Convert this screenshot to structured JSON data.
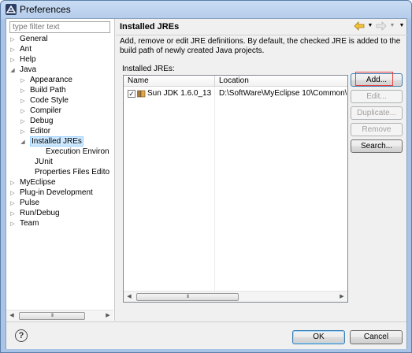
{
  "window": {
    "title": "Preferences",
    "icon": "eclipse-icon"
  },
  "filter": {
    "placeholder": "type filter text"
  },
  "tree": {
    "items": [
      {
        "label": "General",
        "expandable": true,
        "expanded": false
      },
      {
        "label": "Ant",
        "expandable": true,
        "expanded": false
      },
      {
        "label": "Help",
        "expandable": true,
        "expanded": false
      },
      {
        "label": "Java",
        "expandable": true,
        "expanded": true
      },
      {
        "label": "Appearance",
        "expandable": true,
        "expanded": false
      },
      {
        "label": "Build Path",
        "expandable": true,
        "expanded": false
      },
      {
        "label": "Code Style",
        "expandable": true,
        "expanded": false
      },
      {
        "label": "Compiler",
        "expandable": true,
        "expanded": false
      },
      {
        "label": "Debug",
        "expandable": true,
        "expanded": false
      },
      {
        "label": "Editor",
        "expandable": true,
        "expanded": false
      },
      {
        "label": "Installed JREs",
        "expandable": true,
        "expanded": true,
        "selected": true
      },
      {
        "label": "Execution Environ",
        "expandable": false
      },
      {
        "label": "JUnit",
        "expandable": false
      },
      {
        "label": "Properties Files Edito",
        "expandable": false
      },
      {
        "label": "MyEclipse",
        "expandable": true,
        "expanded": false
      },
      {
        "label": "Plug-in Development",
        "expandable": true,
        "expanded": false
      },
      {
        "label": "Pulse",
        "expandable": true,
        "expanded": false
      },
      {
        "label": "Run/Debug",
        "expandable": true,
        "expanded": false
      },
      {
        "label": "Team",
        "expandable": true,
        "expanded": false
      }
    ]
  },
  "page": {
    "title": "Installed JREs",
    "description": "Add, remove or edit JRE definitions. By default, the checked JRE is added to the build path of newly created Java projects.",
    "list_label": "Installed JREs:"
  },
  "table": {
    "columns": [
      "Name",
      "Location"
    ],
    "rows": [
      {
        "checked": true,
        "checkmark": "✓",
        "name": "Sun JDK 1.6.0_13",
        "location": "D:\\SoftWare\\MyEclipse 10\\Common\\b"
      }
    ]
  },
  "buttons": {
    "add": "Add...",
    "edit": "Edit...",
    "duplicate": "Duplicate...",
    "remove": "Remove",
    "search": "Search..."
  },
  "footer": {
    "help": "?",
    "ok": "OK",
    "cancel": "Cancel"
  },
  "scrollbar": {
    "thumb_grip": "III"
  },
  "colors": {
    "selection": "#cde8ff",
    "highlight_box": "#e84040",
    "title_bar": "#b3cbea"
  }
}
